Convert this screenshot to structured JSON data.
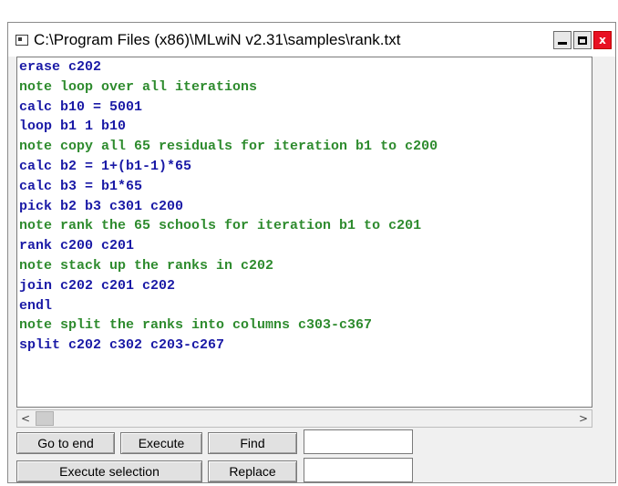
{
  "window": {
    "title": "C:\\Program Files (x86)\\MLwiN v2.31\\samples\\rank.txt"
  },
  "editor": {
    "lines": [
      {
        "text": "erase c202",
        "type": "cmd"
      },
      {
        "text": "note loop over all iterations",
        "type": "note"
      },
      {
        "text": "calc b10 = 5001",
        "type": "cmd"
      },
      {
        "text": "loop b1 1 b10",
        "type": "cmd"
      },
      {
        "text": "note copy all 65 residuals for iteration b1 to c200",
        "type": "note"
      },
      {
        "text": "calc b2 = 1+(b1-1)*65",
        "type": "cmd"
      },
      {
        "text": "calc b3 = b1*65",
        "type": "cmd"
      },
      {
        "text": "pick b2 b3 c301 c200",
        "type": "cmd"
      },
      {
        "text": "note rank the 65 schools for iteration b1 to c201",
        "type": "note"
      },
      {
        "text": "rank c200 c201",
        "type": "cmd"
      },
      {
        "text": "note stack up the ranks in c202",
        "type": "note"
      },
      {
        "text": "join c202 c201 c202",
        "type": "cmd"
      },
      {
        "text": "endl",
        "type": "cmd"
      },
      {
        "text": "note split the ranks into columns c303-c367",
        "type": "note"
      },
      {
        "text": "split c202 c302 c203-c267",
        "type": "cmd"
      }
    ],
    "colors": {
      "cmd": "#1a1aa6",
      "note": "#2e8b2e"
    }
  },
  "scrollbar": {
    "left_arrow": "<",
    "right_arrow": ">"
  },
  "toolbar": {
    "go_to_end": "Go to end",
    "execute": "Execute",
    "find": "Find",
    "find_value": "",
    "execute_selection": "Execute selection",
    "replace": "Replace",
    "replace_value": ""
  },
  "icons": {
    "close": "x",
    "app": "window-icon"
  }
}
